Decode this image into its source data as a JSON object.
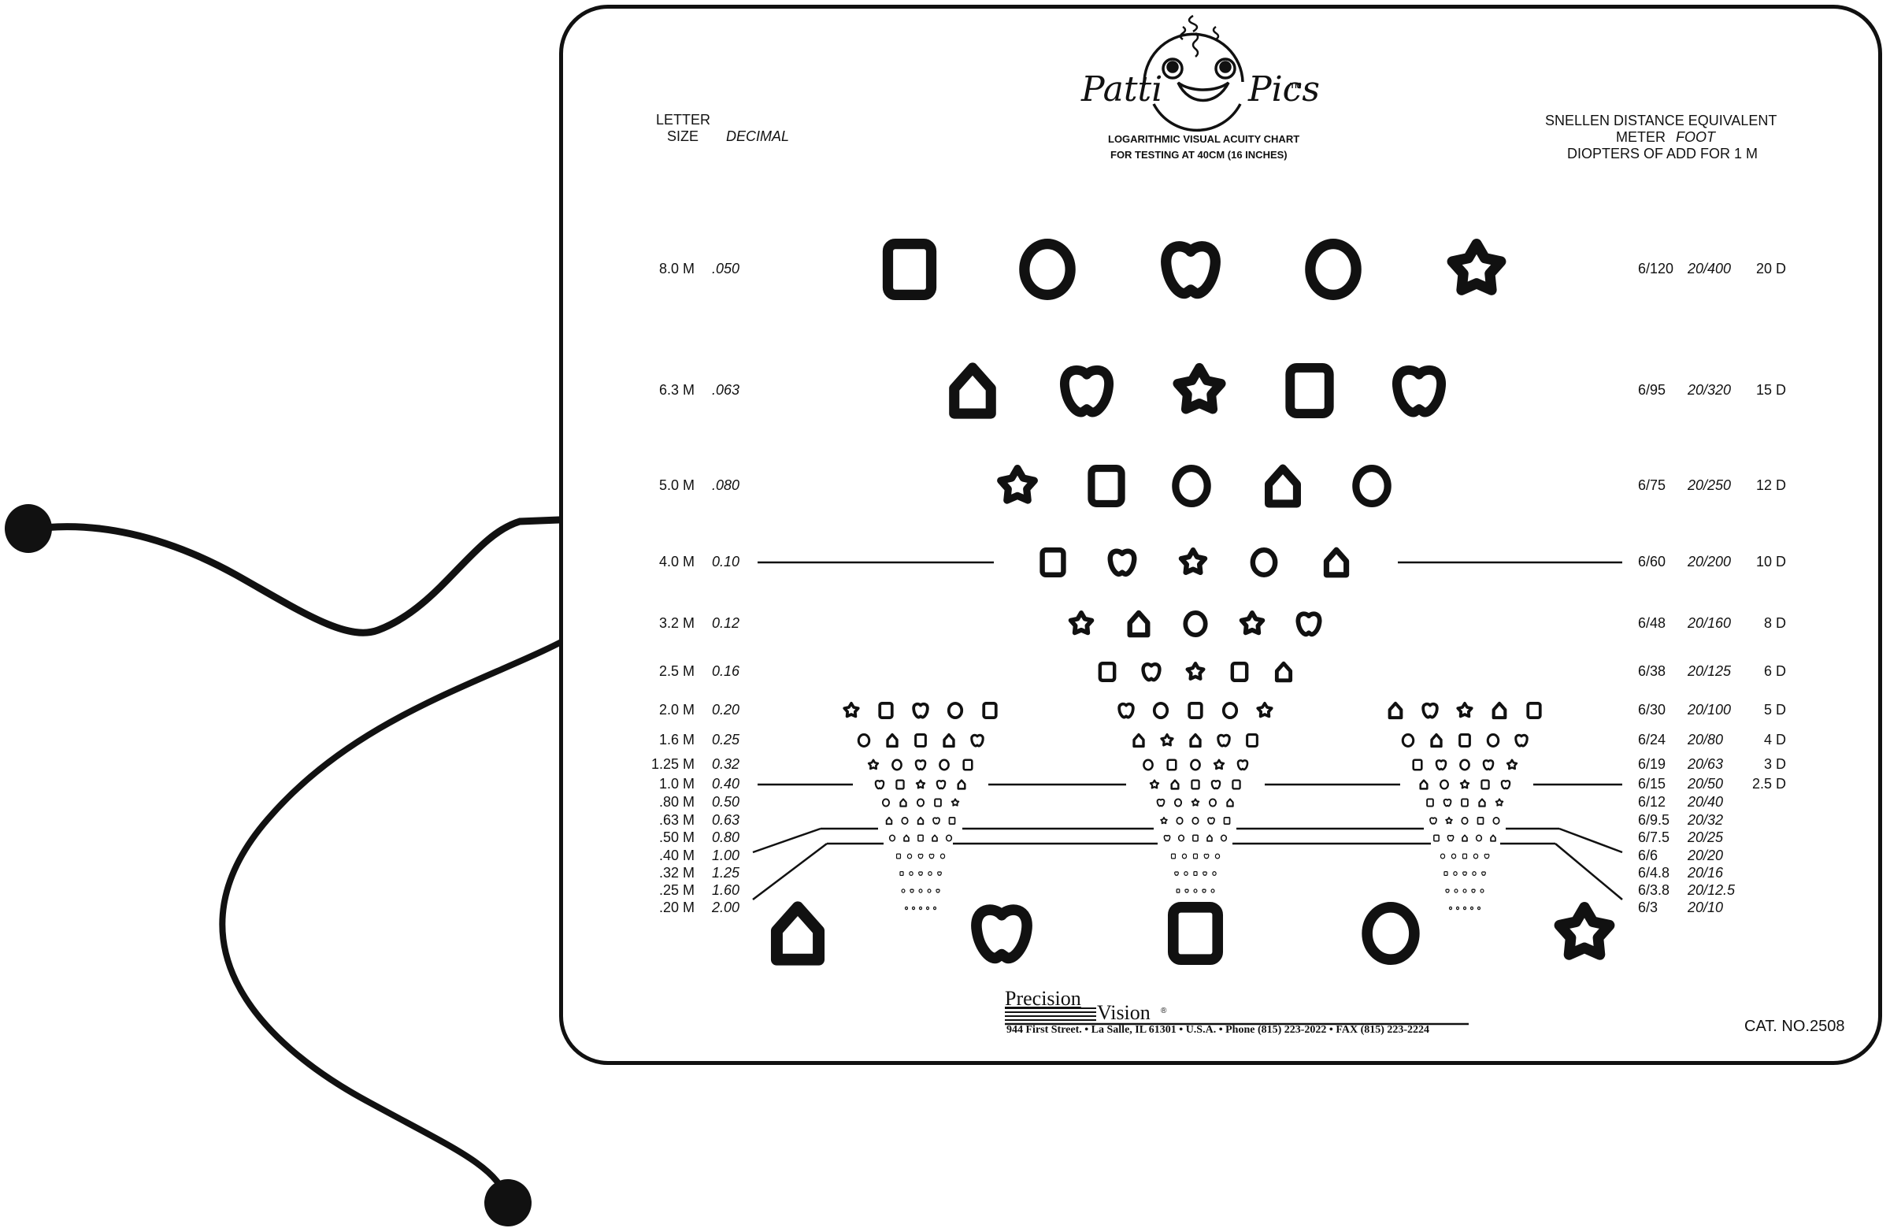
{
  "chart": {
    "brand_name_left": "Patti",
    "brand_name_right": "Pics",
    "trademark": "TM",
    "subtitle_line1": "LOGARITHMIC VISUAL ACUITY CHART",
    "subtitle_line2": "FOR TESTING AT 40CM (16 INCHES)",
    "left_header": {
      "letter": "LETTER",
      "size": "SIZE",
      "decimal": "DECIMAL"
    },
    "right_header": {
      "line1": "SNELLEN DISTANCE EQUIVALENT",
      "meter": "METER",
      "foot": "FOOT",
      "line3": "DIOPTERS OF ADD FOR 1 M"
    },
    "rows": [
      {
        "size": "8.0 M",
        "decimal": ".050",
        "meter": "6/120",
        "foot": "20/400",
        "diopter": "20 D",
        "symbols": [
          "square",
          "circle",
          "apple",
          "circle",
          "star"
        ]
      },
      {
        "size": "6.3 M",
        "decimal": ".063",
        "meter": "6/95",
        "foot": "20/320",
        "diopter": "15 D",
        "symbols": [
          "house",
          "apple",
          "star",
          "square",
          "apple"
        ]
      },
      {
        "size": "5.0 M",
        "decimal": ".080",
        "meter": "6/75",
        "foot": "20/250",
        "diopter": "12 D",
        "symbols": [
          "star",
          "square",
          "circle",
          "house",
          "circle"
        ]
      },
      {
        "size": "4.0 M",
        "decimal": "0.10",
        "meter": "6/60",
        "foot": "20/200",
        "diopter": "10 D",
        "symbols": [
          "square",
          "apple",
          "star",
          "circle",
          "house"
        ]
      },
      {
        "size": "3.2 M",
        "decimal": "0.12",
        "meter": "6/48",
        "foot": "20/160",
        "diopter": "8 D",
        "symbols": [
          "star",
          "house",
          "circle",
          "star",
          "apple"
        ]
      },
      {
        "size": "2.5 M",
        "decimal": "0.16",
        "meter": "6/38",
        "foot": "20/125",
        "diopter": "6 D",
        "symbols": [
          "square",
          "apple",
          "star",
          "square",
          "house"
        ]
      },
      {
        "size": "2.0 M",
        "decimal": "0.20",
        "meter": "6/30",
        "foot": "20/100",
        "diopter": "5 D",
        "groups": [
          [
            "star",
            "square",
            "apple",
            "circle",
            "square"
          ],
          [
            "apple",
            "circle",
            "square",
            "circle",
            "star"
          ],
          [
            "house",
            "apple",
            "star",
            "house",
            "square"
          ]
        ]
      },
      {
        "size": "1.6 M",
        "decimal": "0.25",
        "meter": "6/24",
        "foot": "20/80",
        "diopter": "4 D",
        "groups": [
          [
            "circle",
            "house",
            "square",
            "house",
            "apple"
          ],
          [
            "house",
            "star",
            "house",
            "apple",
            "square"
          ],
          [
            "circle",
            "house",
            "square",
            "circle",
            "apple"
          ]
        ]
      },
      {
        "size": "1.25 M",
        "decimal": "0.32",
        "meter": "6/19",
        "foot": "20/63",
        "diopter": "3 D",
        "groups": [
          [
            "star",
            "circle",
            "apple",
            "circle",
            "square"
          ],
          [
            "circle",
            "square",
            "circle",
            "star",
            "apple"
          ],
          [
            "square",
            "apple",
            "circle",
            "apple",
            "star"
          ]
        ]
      },
      {
        "size": "1.0 M",
        "decimal": "0.40",
        "meter": "6/15",
        "foot": "20/50",
        "diopter": "2.5 D",
        "groups": [
          [
            "apple",
            "square",
            "star",
            "apple",
            "house"
          ],
          [
            "star",
            "house",
            "square",
            "apple",
            "square"
          ],
          [
            "house",
            "circle",
            "star",
            "square",
            "apple"
          ]
        ]
      },
      {
        "size": ".80 M",
        "decimal": "0.50",
        "meter": "6/12",
        "foot": "20/40",
        "diopter": "",
        "groups": [
          [
            "circle",
            "house",
            "circle",
            "square",
            "star"
          ],
          [
            "apple",
            "circle",
            "star",
            "circle",
            "house"
          ],
          [
            "square",
            "apple",
            "square",
            "house",
            "star"
          ]
        ]
      },
      {
        "size": ".63 M",
        "decimal": "0.63",
        "meter": "6/9.5",
        "foot": "20/32",
        "diopter": "",
        "groups": [
          [
            "house",
            "circle",
            "house",
            "apple",
            "square"
          ],
          [
            "star",
            "circle",
            "circle",
            "apple",
            "square"
          ],
          [
            "apple",
            "star",
            "circle",
            "square",
            "circle"
          ]
        ]
      },
      {
        "size": ".50 M",
        "decimal": "0.80",
        "meter": "6/7.5",
        "foot": "20/25",
        "diopter": "",
        "groups": [
          [
            "circle",
            "house",
            "square",
            "house",
            "circle"
          ],
          [
            "apple",
            "circle",
            "square",
            "house",
            "circle"
          ],
          [
            "square",
            "apple",
            "house",
            "circle",
            "house"
          ]
        ]
      },
      {
        "size": ".40 M",
        "decimal": "1.00",
        "meter": "6/6",
        "foot": "20/20",
        "diopter": "",
        "groups": [
          [
            "square",
            "circle",
            "apple",
            "apple",
            "circle"
          ],
          [
            "square",
            "circle",
            "square",
            "apple",
            "circle"
          ],
          [
            "circle",
            "circle",
            "square",
            "circle",
            "apple"
          ]
        ]
      },
      {
        "size": ".32 M",
        "decimal": "1.25",
        "meter": "6/4.8",
        "foot": "20/16",
        "diopter": "",
        "groups": [
          [
            "square",
            "circle",
            "apple",
            "circle",
            "apple"
          ],
          [
            "apple",
            "circle",
            "square",
            "apple",
            "circle"
          ],
          [
            "square",
            "circle",
            "apple",
            "circle",
            "apple"
          ]
        ]
      },
      {
        "size": ".25 M",
        "decimal": "1.60",
        "meter": "6/3.8",
        "foot": "20/12.5",
        "diopter": "",
        "groups": [
          [
            "circle",
            "apple",
            "circle",
            "circle",
            "apple"
          ],
          [
            "square",
            "apple",
            "circle",
            "apple",
            "circle"
          ],
          [
            "apple",
            "circle",
            "circle",
            "apple",
            "circle"
          ]
        ]
      },
      {
        "size": ".20 M",
        "decimal": "2.00",
        "meter": "6/3",
        "foot": "20/10",
        "diopter": "",
        "groups": [
          [
            "circle",
            "circle",
            "circle",
            "circle",
            "circle"
          ],
          [
            "circle",
            "circle",
            "circle",
            "circle",
            "circle"
          ],
          [
            "circle",
            "circle",
            "circle",
            "circle",
            "circle"
          ]
        ]
      }
    ],
    "bottom_symbols": [
      "house",
      "apple",
      "square",
      "circle",
      "star"
    ],
    "footer": {
      "company_line1": "Precision",
      "company_line2": "Vision",
      "registered": "®",
      "address": "944 First Street. • La Salle, IL 61301 • U.S.A. • Phone (815) 223-2022 • FAX (815) 223-2224",
      "catalog": "CAT. NO.2508"
    }
  },
  "colors": {
    "ink": "#111111",
    "paper": "#ffffff"
  }
}
